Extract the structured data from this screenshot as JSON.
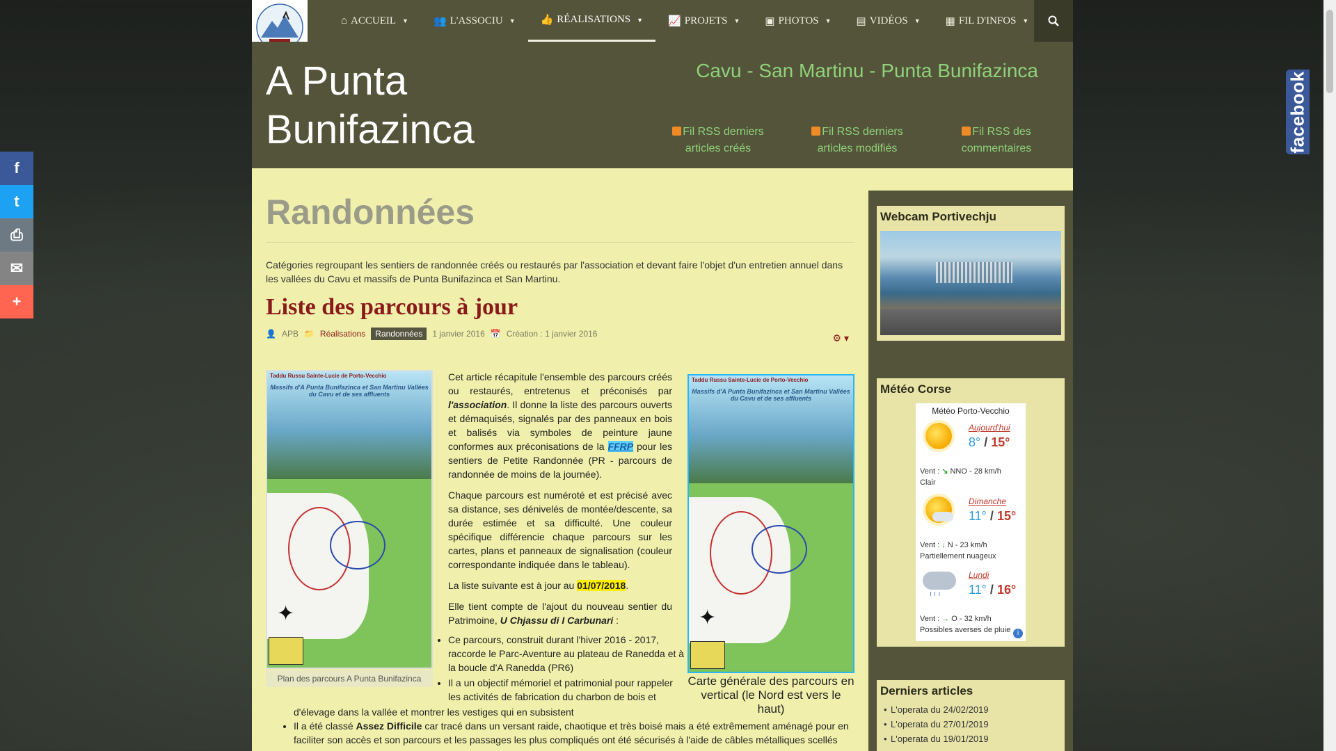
{
  "social": {
    "facebook": "f",
    "twitter": "t",
    "print": "⎙",
    "email": "✉",
    "more": "+"
  },
  "facebook_tab": "facebook",
  "nav": {
    "items": [
      {
        "icon": "home-icon",
        "label": "ACCUEIL"
      },
      {
        "icon": "users-icon",
        "label": "L'ASSOCIU"
      },
      {
        "icon": "thumbs-up-icon",
        "label": "RÉALISATIONS"
      },
      {
        "icon": "chart-icon",
        "label": "PROJETS"
      },
      {
        "icon": "image-icon",
        "label": "PHOTOS"
      },
      {
        "icon": "film-icon",
        "label": "VIDÉOS"
      },
      {
        "icon": "newspaper-icon",
        "label": "FIL D'INFOS"
      }
    ],
    "active_index": 2
  },
  "header": {
    "site_title": "A Punta Bunifazinca",
    "tagline": "Cavu - San Martinu - Punta Bunifazinca",
    "rss": [
      "Fil RSS derniers articles créés",
      "Fil RSS derniers articles modifiés",
      "Fil RSS des commentaires"
    ]
  },
  "main": {
    "page_title": "Randonnées",
    "category_description": "Catégories regroupant les sentiers de randonnée créés ou restaurés par l'association et devant faire l'objet d'un entretien annuel dans les vallées du Cavu et massifs de Punta Bunifazinca et San Martinu.",
    "article_title": "Liste des parcours à jour",
    "meta": {
      "author": "APB",
      "parent_category": "Réalisations",
      "category": "Randonnées",
      "published": "1 janvier 2016",
      "created": "Création : 1 janvier 2016"
    },
    "image_left_caption": "Plan des parcours A Punta Bunifazinca",
    "image_right_caption": "Carte générale des parcours en vertical (le Nord est vers le haut)",
    "map": {
      "header": "Taddu Russu        Sainte-Lucie de Porto-Vecchio",
      "subtitle": "Massifs d'A Punta Bunifazinca et San Martinu Vallées du Cavu et de ses affluents"
    },
    "text": {
      "p1_a": "Cet article récapitule l'ensemble des parcours créés ou restaurés, entretenus et préconisés par ",
      "p1_assoc": "l'association",
      "p1_b": ". Il donne la liste des parcours ouverts et démaquisés, signalés par des panneaux en bois et balisés via symboles de peinture jaune conformes aux préconisations de la ",
      "p1_ffrp": "FFRP",
      "p1_c": " pour les sentiers de Petite Randonnée (PR - parcours de randonnée de moins de la journée).",
      "p2": "Chaque parcours est numéroté et est précisé avec sa distance, ses dénivelés de montée/descente, sa durée estimée et sa difficulté. Une couleur spécifique différencie chaque parcours sur les cartes, plans et panneaux de signalisation (couleur correspondante indiquée dans le tableau).",
      "p3_a": "La liste suivante est à jour au ",
      "p3_date": "01/07/2018",
      "p3_b": ".",
      "p4_a": "Elle tient compte de l'ajout du nouveau sentier du Patrimoine, ",
      "p4_name": "U Chjassu di I Carbunari",
      "p4_b": " :",
      "bullet1": "Ce parcours, construit durant l'hiver 2016 - 2017, raccorde le Parc-Aventure au plateau de Ranedda et à la boucle d'A Ranedda (PR6)",
      "bullet2": "Il a un objectif mémoriel et patrimonial pour rappeler les activités de fabrication du charbon de bois et",
      "bullet2_cont": "d'élevage dans la vallée et montrer les vestiges qui en subsistent",
      "bullet3_a": "Il a été classé ",
      "bullet3_strong": "Assez Difficile",
      "bullet3_b": " car tracé dans un versant raide, chaotique et très boisé mais a été extrêmement aménagé pour en faciliter son accès et son parcours et les passages les plus compliqués ont été sécurisés à l'aide de câbles métalliques scellés"
    }
  },
  "sidebar": {
    "webcam_title": "Webcam Portivechju",
    "meteo_title": "Météo Corse",
    "meteo": {
      "location": "Météo Porto-Vecchio",
      "days": [
        {
          "name": "Aujourd'hui",
          "min": "8°",
          "max": "15°",
          "wind": "Vent : ",
          "wind_dir": "NNO - 28 km/h",
          "sky": "Clair",
          "icon": "sun-icon"
        },
        {
          "name": "Dimanche",
          "min": "11°",
          "max": "15°",
          "wind": "Vent : ",
          "wind_dir": "N - 23 km/h",
          "sky": "Partiellement nuageux",
          "icon": "partly-cloudy-icon"
        },
        {
          "name": "Lundi",
          "min": "11°",
          "max": "16°",
          "wind": "Vent : ",
          "wind_dir": "O - 32 km/h",
          "sky": "Possibles averses de pluie",
          "icon": "rain-icon"
        }
      ]
    },
    "articles_title": "Derniers articles",
    "articles": [
      "L'operata du 24/02/2019",
      "L'operata du 27/01/2019",
      "L'operata du 19/01/2019"
    ]
  }
}
